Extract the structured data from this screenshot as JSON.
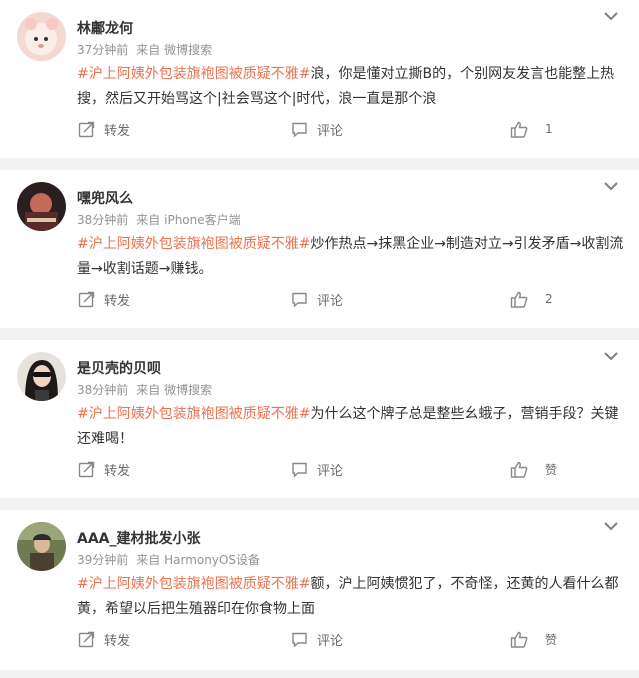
{
  "labels": {
    "repost": "转发",
    "comment": "评论",
    "src_prefix": "来自"
  },
  "posts": [
    {
      "username": "林鄘龙何",
      "time": "37分钟前",
      "source": "微博搜索",
      "hashtag": "#沪上阿姨外包装旗袍图被质疑不雅#",
      "text": "浪，你是懂对立撕B的，个别网友发言也能整上热搜，然后又开始骂这个|社会骂这个|时代，浪一直是那个浪",
      "likes": "1"
    },
    {
      "username": "嘿兜风么",
      "time": "38分钟前",
      "source": "iPhone客户端",
      "hashtag": "#沪上阿姨外包装旗袍图被质疑不雅#",
      "text": "炒作热点→抹黑企业→制造对立→引发矛盾→收割流量→收割话题→赚钱。",
      "likes": "2"
    },
    {
      "username": "是贝壳的贝呗",
      "time": "38分钟前",
      "source": "微博搜索",
      "hashtag": "#沪上阿姨外包装旗袍图被质疑不雅#",
      "text": "为什么这个牌子总是整些幺蛾子，营销手段？关键还难喝！",
      "likes": "赞"
    },
    {
      "username": "AAA_建材批发小张",
      "time": "39分钟前",
      "source": "HarmonyOS设备",
      "hashtag": "#沪上阿姨外包装旗袍图被质疑不雅#",
      "text": "额，沪上阿姨惯犯了，不奇怪，还黄的人看什么都黄，希望以后把生殖器印在你食物上面",
      "likes": "赞"
    }
  ]
}
